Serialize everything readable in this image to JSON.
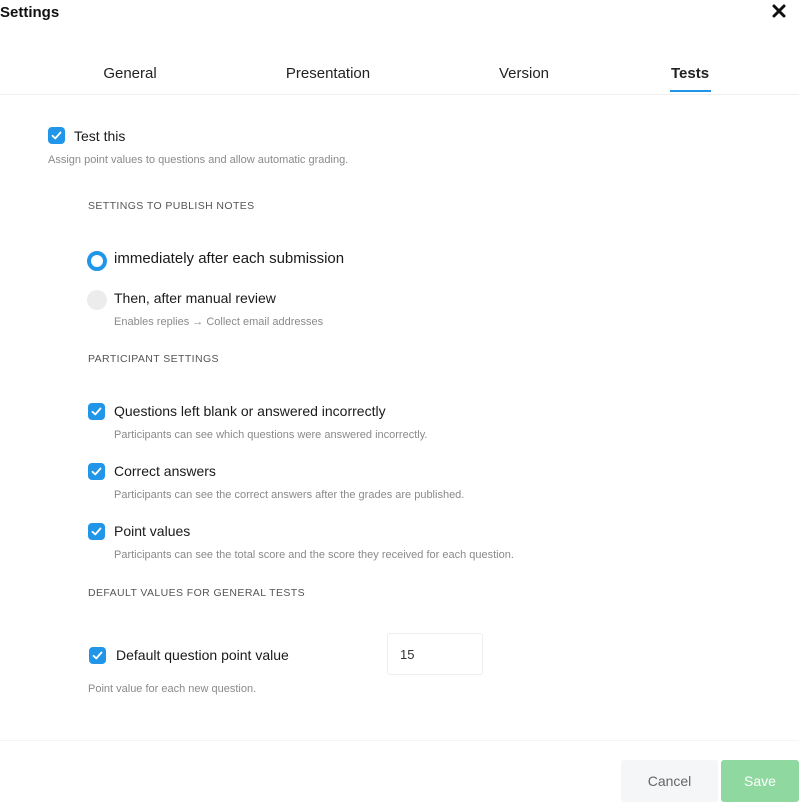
{
  "header": {
    "title": "Settings"
  },
  "tabs": [
    {
      "label": "General"
    },
    {
      "label": "Presentation"
    },
    {
      "label": "Version"
    },
    {
      "label": "Tests"
    }
  ],
  "active_tab": "Tests",
  "test_toggle": {
    "label": "Test this",
    "checked": true,
    "description": "Assign point values to questions and allow automatic grading."
  },
  "publish": {
    "heading": "SETTINGS TO PUBLISH NOTES",
    "options": [
      {
        "label": "immediately after each submission",
        "selected": true
      },
      {
        "label": "Then, after manual review",
        "selected": false,
        "sublabel": "Enables replies → Collect email addresses"
      }
    ]
  },
  "participant": {
    "heading": "PARTICIPANT SETTINGS",
    "items": [
      {
        "label": "Questions left blank or answered incorrectly",
        "checked": true,
        "description": "Participants can see which questions were answered incorrectly."
      },
      {
        "label": "Correct answers",
        "checked": true,
        "description": "Participants can see the correct answers after the grades are published."
      },
      {
        "label": "Point values",
        "checked": true,
        "description": "Participants can see the total score and the score they received for each question."
      }
    ]
  },
  "defaults": {
    "heading": "DEFAULT VALUES FOR GENERAL TESTS",
    "point_label": "Default question point value",
    "point_checked": true,
    "point_value": "15",
    "note": "Point value for each new question."
  },
  "footer": {
    "cancel": "Cancel",
    "save": "Save"
  },
  "colors": {
    "accent": "#2196e8",
    "save": "#8fd8a0",
    "cancel_bg": "#f5f6f8"
  }
}
